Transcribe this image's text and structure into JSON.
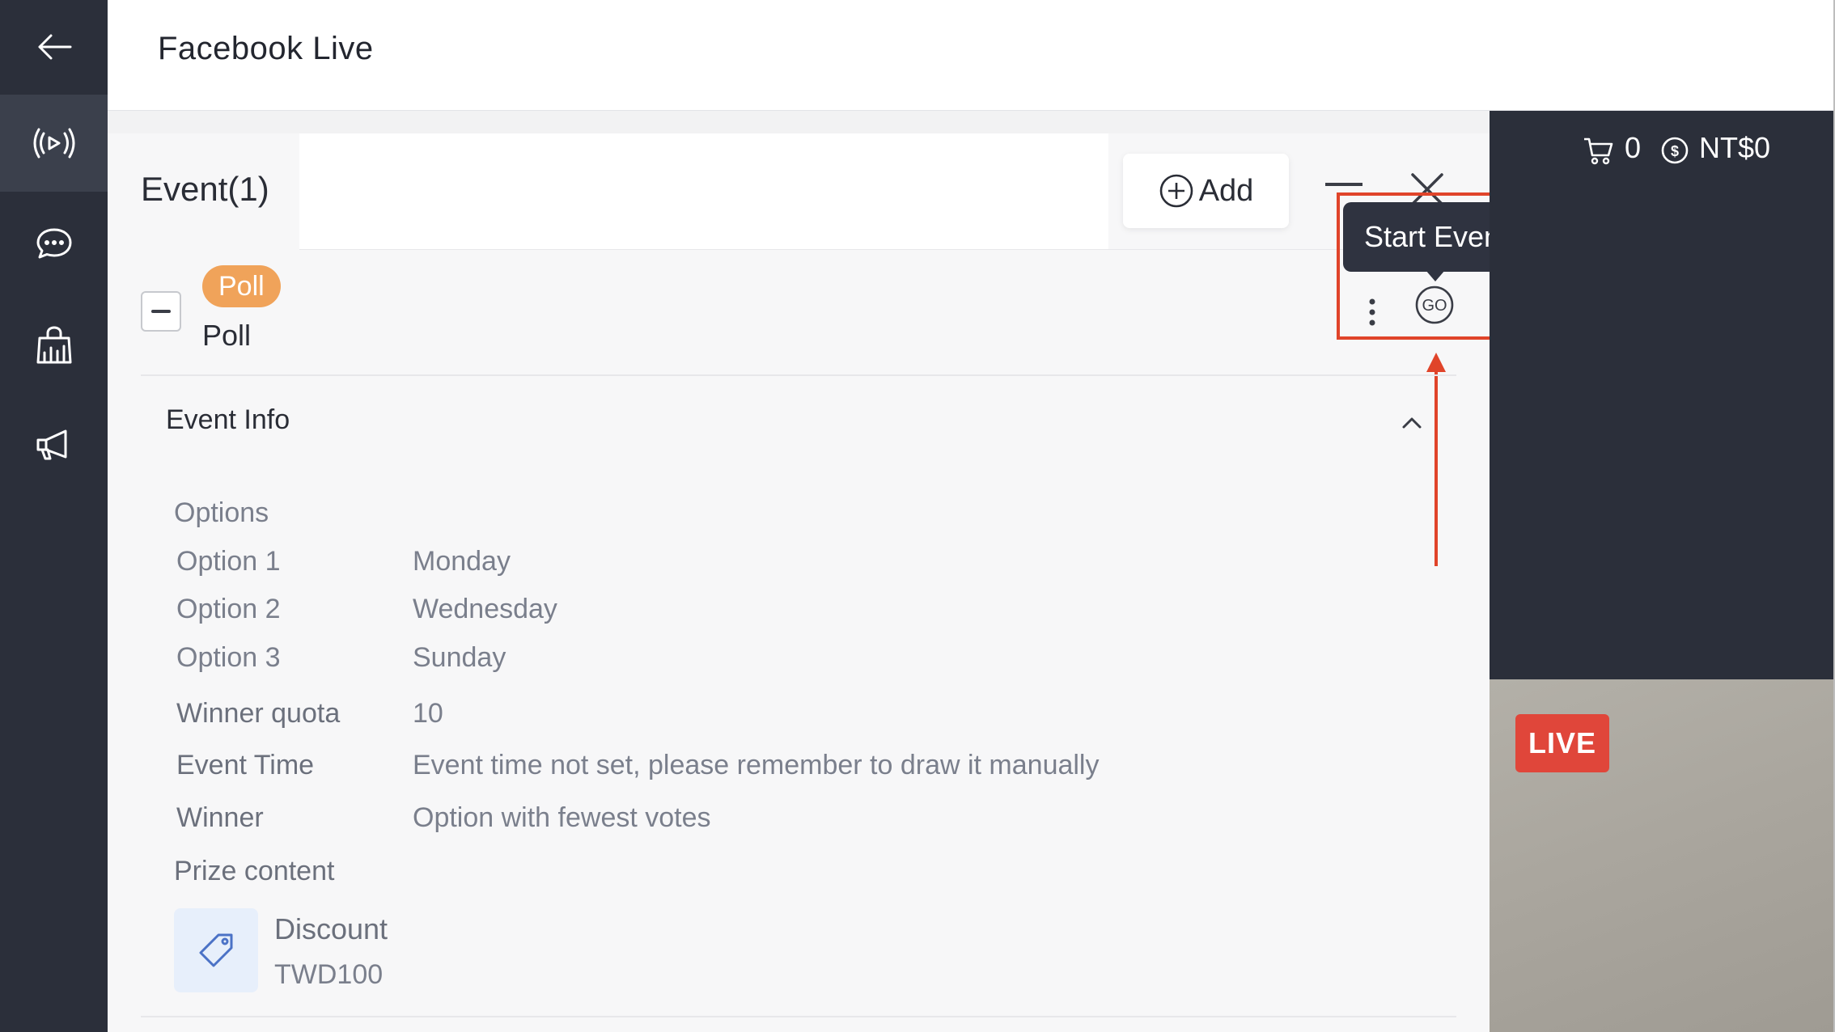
{
  "header": {
    "title": "Facebook Live"
  },
  "nav": {
    "items": [
      {
        "name": "back-arrow-icon"
      },
      {
        "name": "live-broadcast-icon"
      },
      {
        "name": "chat-bubble-icon"
      },
      {
        "name": "shopping-bag-icon"
      },
      {
        "name": "megaphone-icon"
      }
    ]
  },
  "panel": {
    "title": "Event(1)",
    "add_label": "Add"
  },
  "event": {
    "badge": "Poll",
    "name": "Poll",
    "tooltip": "Start Event",
    "go_label": "GO"
  },
  "event_info": {
    "title": "Event Info",
    "options_label": "Options",
    "options": [
      {
        "label": "Option 1",
        "value": "Monday"
      },
      {
        "label": "Option 2",
        "value": "Wednesday"
      },
      {
        "label": "Option 3",
        "value": "Sunday"
      }
    ],
    "winner_quota_label": "Winner quota",
    "winner_quota_value": "10",
    "event_time_label": "Event Time",
    "event_time_value": "Event time not set, please remember to draw it manually",
    "winner_label": "Winner",
    "winner_value": "Option with fewest votes",
    "prize_label": "Prize content",
    "prize_name": "Discount",
    "prize_code": "TWD100"
  },
  "stream": {
    "cart_count": "0",
    "balance": "NT$0",
    "live_label": "LIVE"
  },
  "colors": {
    "sidebar": "#2b2f3a",
    "accent_badge": "#f0a35a",
    "highlight": "#e0442a",
    "live": "#e0463a"
  }
}
